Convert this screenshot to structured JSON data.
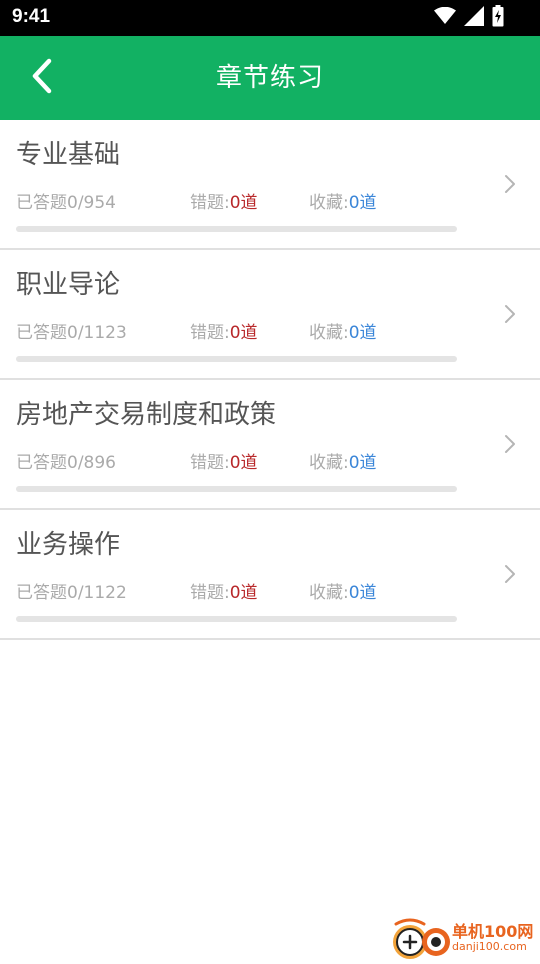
{
  "status_bar": {
    "time": "9:41",
    "icons": [
      "wifi-icon",
      "signal-icon",
      "battery-charging-icon"
    ]
  },
  "app_bar": {
    "title": "章节练习",
    "back_icon": "chevron-left-icon",
    "background": "#12b163"
  },
  "chapters": [
    {
      "title": "专业基础",
      "answered_label": "已答题",
      "answered": "0/954",
      "wrong_label": "错题:",
      "wrong_value": "0道",
      "fav_label": "收藏:",
      "fav_value": "0道",
      "progress": 0
    },
    {
      "title": "职业导论",
      "answered_label": "已答题",
      "answered": "0/1123",
      "wrong_label": "错题:",
      "wrong_value": "0道",
      "fav_label": "收藏:",
      "fav_value": "0道",
      "progress": 0
    },
    {
      "title": "房地产交易制度和政策",
      "answered_label": "已答题",
      "answered": "0/896",
      "wrong_label": "错题:",
      "wrong_value": "0道",
      "fav_label": "收藏:",
      "fav_value": "0道",
      "progress": 0
    },
    {
      "title": "业务操作",
      "answered_label": "已答题",
      "answered": "0/1122",
      "wrong_label": "错题:",
      "wrong_value": "0道",
      "fav_label": "收藏:",
      "fav_value": "0道",
      "progress": 0
    }
  ],
  "colors": {
    "accent": "#12b163",
    "wrong": "#b8282a",
    "favorite": "#3b86d8"
  },
  "watermark": {
    "name": "单机100网",
    "domain": "danji100.com"
  }
}
